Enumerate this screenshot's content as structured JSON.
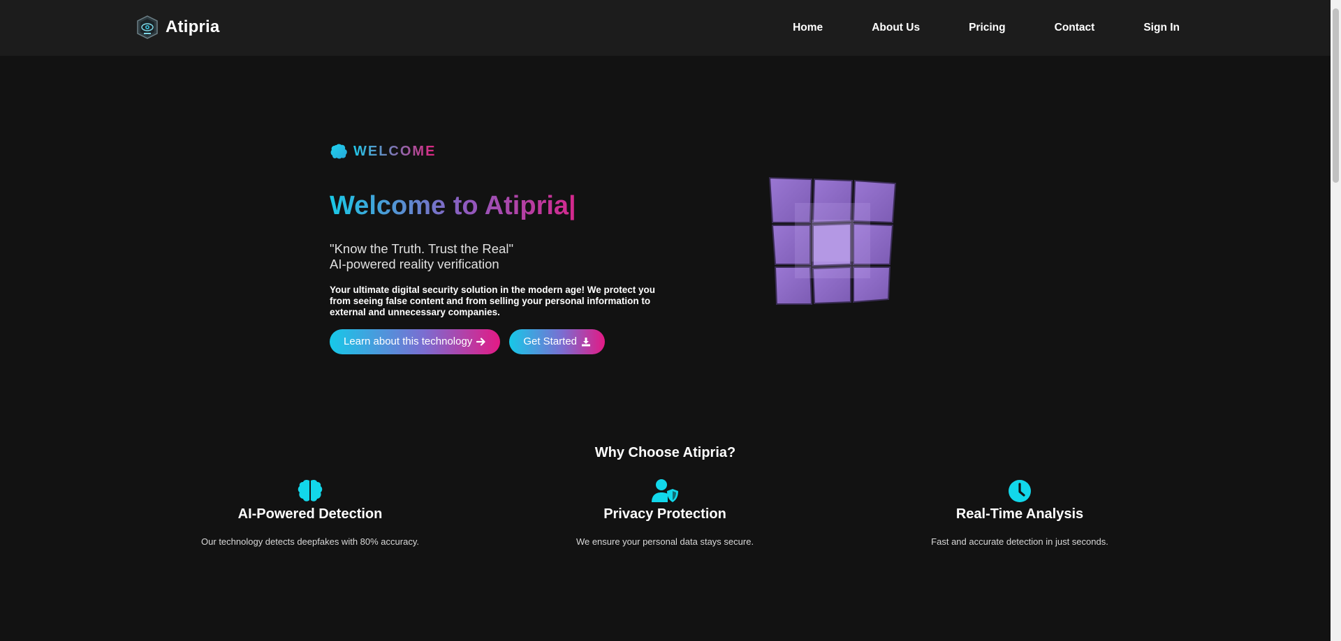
{
  "nav": {
    "brand": "Atipria",
    "links": [
      "Home",
      "About Us",
      "Pricing",
      "Contact",
      "Sign In"
    ]
  },
  "hero": {
    "badge": "WELCOME",
    "title": "Welcome to Atipria|",
    "tagline_1": "\"Know the Truth. Trust the Real\"",
    "tagline_2": "AI-powered reality verification",
    "description": "Your ultimate digital security solution in the modern age! We protect you from seeing false content and from selling your personal information to external and unnecessary companies.",
    "primary_button": "Learn about this technology",
    "secondary_button": "Get Started"
  },
  "features": {
    "heading": "Why Choose Atipria?",
    "items": [
      {
        "icon": "brain-icon",
        "title": "AI-Powered Detection",
        "desc": "Our technology detects deepfakes with 80% accuracy."
      },
      {
        "icon": "user-shield-icon",
        "title": "Privacy Protection",
        "desc": "We ensure your personal data stays secure."
      },
      {
        "icon": "clock-icon",
        "title": "Real-Time Analysis",
        "desc": "Fast and accurate detection in just seconds."
      }
    ]
  },
  "colors": {
    "background": "#121212",
    "navbar": "#1c1c1c",
    "accent_cyan": "#17c8e8",
    "accent_pink": "#e31a85",
    "cube_purple": "#8f6bc4"
  }
}
